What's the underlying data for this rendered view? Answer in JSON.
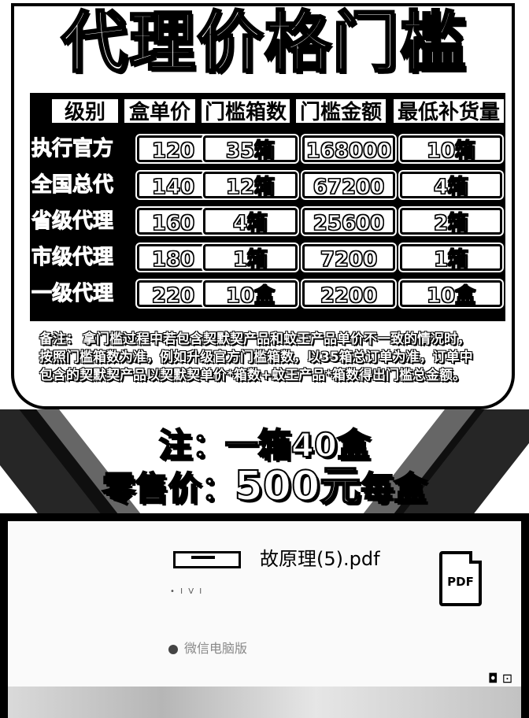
{
  "poster": {
    "title": "代理价格门槛",
    "headers": [
      "级别",
      "盒单价",
      "门槛箱数",
      "门槛金额",
      "最低补货量"
    ],
    "rows": [
      {
        "level": "执行官方",
        "unit_price": "120",
        "box_count": "35箱",
        "amount": "168000",
        "min_restock": "10箱"
      },
      {
        "level": "全国总代",
        "unit_price": "140",
        "box_count": "12箱",
        "amount": "67200",
        "min_restock": "4箱"
      },
      {
        "level": "省级代理",
        "unit_price": "160",
        "box_count": "4箱",
        "amount": "25600",
        "min_restock": "2箱"
      },
      {
        "level": "市级代理",
        "unit_price": "180",
        "box_count": "1箱",
        "amount": "7200",
        "min_restock": "1箱"
      },
      {
        "level": "一级代理",
        "unit_price": "220",
        "box_count": "10盒",
        "amount": "2200",
        "min_restock": "10盒"
      }
    ],
    "note_label": "备注：",
    "note_text": "拿门槛过程中若包含契默契产品和蚊王产品单价不一致的情况时，按照门槛箱数为准，例如升级官方门槛箱数，以35箱总订单为准，订单中包含的契默契产品以契默契单价*箱数+蚊王产品*箱数得出门槛总金额。",
    "footnote_box": "注：一箱40盒",
    "retail_label": "零售价：",
    "retail_price": "500元",
    "retail_unit": "每盒"
  },
  "chat": {
    "file_name": "故原理(5).pdf",
    "file_type_label": "PDF",
    "small_caption": "• I V I",
    "source_label": "微信电脑版",
    "corner_icons": "◘ ⊡"
  }
}
